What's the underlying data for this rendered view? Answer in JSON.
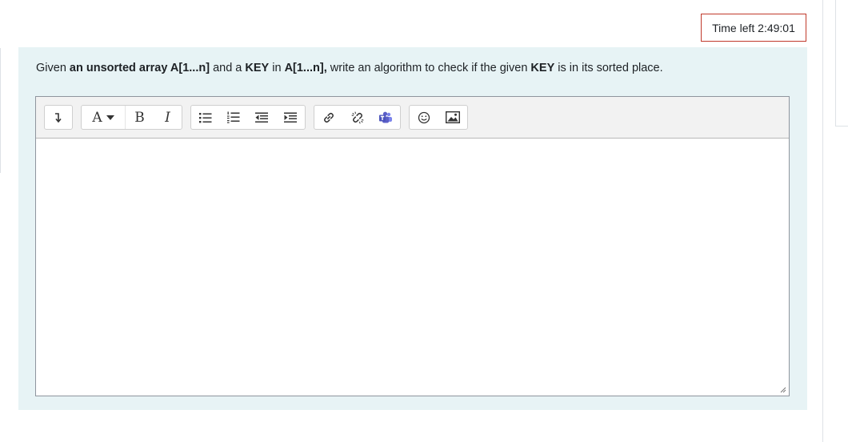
{
  "timer": {
    "label": "Time left",
    "value": "2:49:01"
  },
  "question": {
    "part1": "Given ",
    "bold1": "an unsorted array A[1...n]",
    "part2": " and a ",
    "bold2": "KEY",
    "part3": " in ",
    "bold3": "A[1...n],",
    "part4": " write an algorithm to check if the given ",
    "bold4": "KEY",
    "part5": " is in its sorted place."
  },
  "toolbar": {
    "font_button_label": "A",
    "bold_label": "B",
    "italic_label": "I",
    "icons": [
      "collapse-toolbar-icon",
      "font-style-icon",
      "bold-icon",
      "italic-icon",
      "unordered-list-icon",
      "ordered-list-icon",
      "outdent-icon",
      "indent-icon",
      "link-icon",
      "unlink-icon",
      "teams-meeting-icon",
      "emoji-icon",
      "image-icon"
    ]
  },
  "editor": {
    "content": ""
  },
  "colors": {
    "question_background": "#e7f3f5",
    "timer_border": "#c0392b",
    "toolbar_background": "#f2f2f2",
    "teams_icon": "#5b5fc7"
  }
}
